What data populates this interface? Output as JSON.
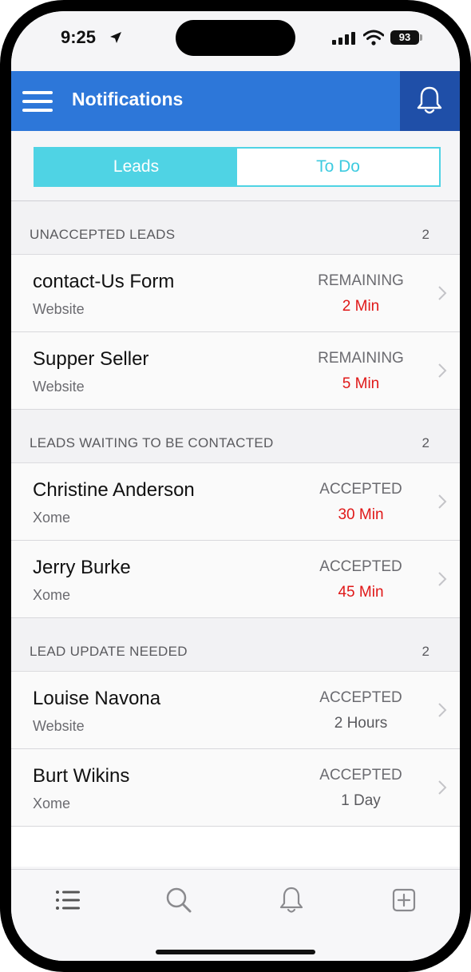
{
  "status_bar": {
    "time": "9:25",
    "battery": "93"
  },
  "navbar": {
    "title": "Notifications"
  },
  "segments": {
    "leads": "Leads",
    "todo": "To Do"
  },
  "sections": [
    {
      "title": "UNACCEPTED LEADS",
      "count": "2",
      "rows": [
        {
          "name": "contact-Us Form",
          "source": "Website",
          "status": "REMAINING",
          "time": "2 Min"
        },
        {
          "name": "Supper Seller",
          "source": "Website",
          "status": "REMAINING",
          "time": "5 Min"
        }
      ]
    },
    {
      "title": "LEADS WAITING TO BE CONTACTED",
      "count": "2",
      "rows": [
        {
          "name": "Christine Anderson",
          "source": "Xome",
          "status": "ACCEPTED",
          "time": "30 Min"
        },
        {
          "name": "Jerry Burke",
          "source": "Xome",
          "status": "ACCEPTED",
          "time": "45 Min"
        }
      ]
    },
    {
      "title": "LEAD UPDATE NEEDED",
      "count": "2",
      "rows": [
        {
          "name": "Louise Navona",
          "source": "Website",
          "status": "ACCEPTED",
          "time": "2 Hours"
        },
        {
          "name": "Burt Wikins",
          "source": "Xome",
          "status": "ACCEPTED",
          "time": "1 Day"
        }
      ]
    }
  ],
  "tab_bar": {
    "icons": [
      "list-icon",
      "search-icon",
      "bell-icon",
      "plus-square-icon"
    ]
  },
  "colors": {
    "navbar": "#2d77d9",
    "bell_button": "#1f4fa8",
    "accent": "#4fd3e4",
    "urgent": "#e01818"
  }
}
